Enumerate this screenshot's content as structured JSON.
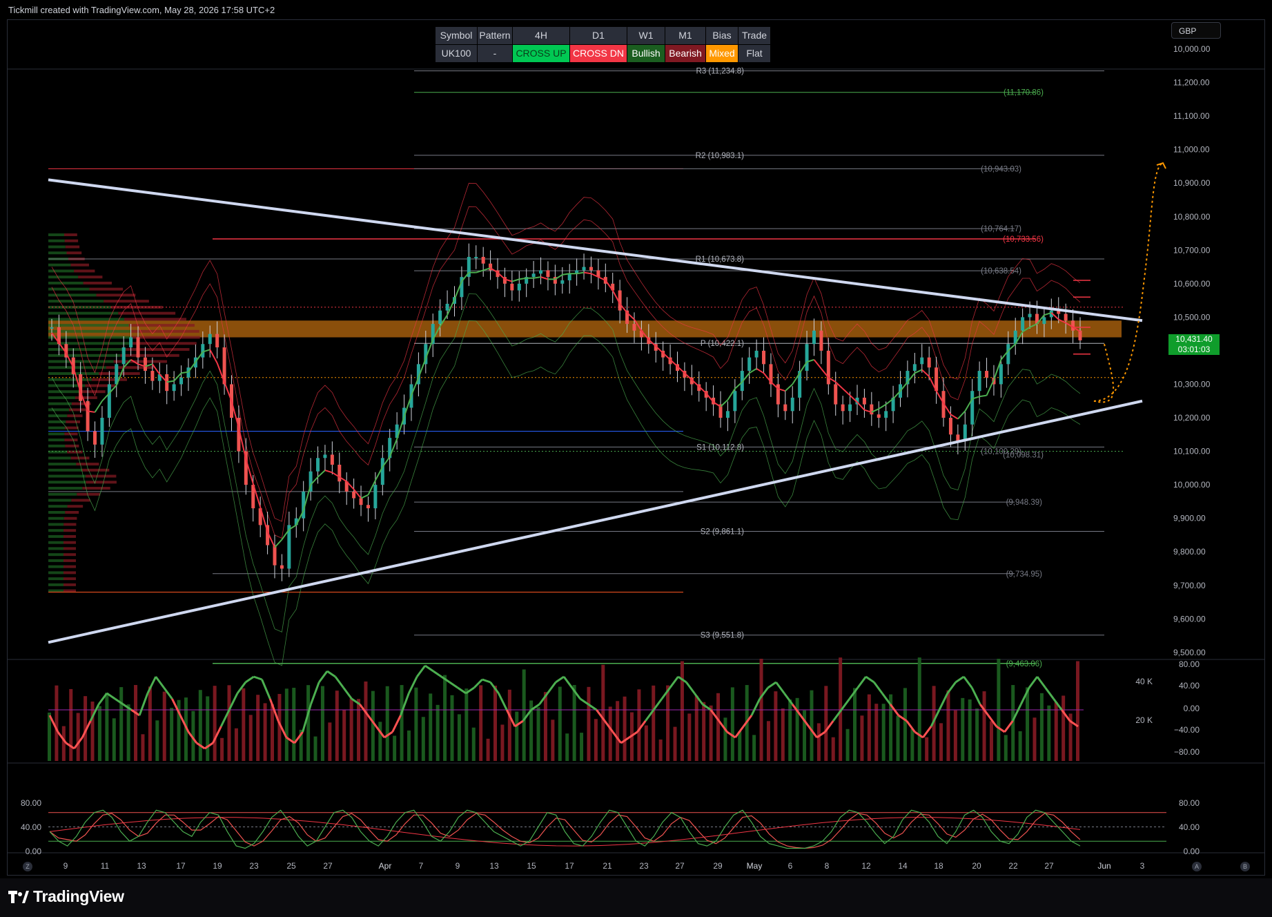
{
  "header": {
    "credit": "Tickmill created with TradingView.com, May 28, 2026 17:58 UTC+2"
  },
  "currency_button": "GBP",
  "brand": "TradingView",
  "table": {
    "headers": [
      "Symbol",
      "Pattern",
      "4H",
      "D1",
      "W1",
      "M1",
      "Bias",
      "Trade"
    ],
    "cells": [
      {
        "text": "UK100",
        "bg": "#2a2e39",
        "fg": "#d1d4dc"
      },
      {
        "text": "-",
        "bg": "#2a2e39",
        "fg": "#d1d4dc"
      },
      {
        "text": "CROSS UP",
        "bg": "#00c853",
        "fg": "#0a3d1a"
      },
      {
        "text": "CROSS DN",
        "bg": "#f23645",
        "fg": "#ffffff"
      },
      {
        "text": "Bullish",
        "bg": "#1b5e20",
        "fg": "#ffffff"
      },
      {
        "text": "Bearish",
        "bg": "#801922",
        "fg": "#ffffff"
      },
      {
        "text": "Mixed",
        "bg": "#ff9800",
        "fg": "#ffffff"
      },
      {
        "text": "Flat",
        "bg": "#2a2e39",
        "fg": "#d1d4dc"
      }
    ]
  },
  "current_price": {
    "value": "10,431.40",
    "countdown": "03:01:03"
  },
  "chart_data": {
    "type": "line",
    "symbol": "UK100",
    "price_axis": {
      "labels": [
        "10,000.00",
        "11,200.00",
        "11,100.00",
        "11,000.00",
        "10,900.00",
        "10,800.00",
        "10,700.00",
        "10,600.00",
        "10,500.00",
        "10,300.00",
        "10,200.00",
        "10,100.00",
        "10,000.00",
        "9,900.00",
        "9,800.00",
        "9,700.00",
        "9,600.00",
        "9,500.00"
      ],
      "ylim": [
        9460,
        11260
      ]
    },
    "x_axis": {
      "labels": [
        "9",
        "11",
        "13",
        "17",
        "19",
        "23",
        "25",
        "27",
        "Apr",
        "7",
        "9",
        "13",
        "15",
        "17",
        "21",
        "23",
        "27",
        "29",
        "May",
        "6",
        "8",
        "12",
        "14",
        "18",
        "20",
        "22",
        "27",
        "Jun",
        "3"
      ]
    },
    "pivot_levels": [
      {
        "label": "R3 (11,234.8)",
        "value": 11234.8
      },
      {
        "label": "R2 (10,983.1)",
        "value": 10983.1
      },
      {
        "label": "R1 (10,673.8)",
        "value": 10673.8
      },
      {
        "label": "P (10,422.1)",
        "value": 10422.1
      },
      {
        "label": "S1 (10,112.8)",
        "value": 10112.8
      },
      {
        "label": "S2 (9,861.1)",
        "value": 9861.1
      },
      {
        "label": "S3 (9,551.8)",
        "value": 9551.8
      }
    ],
    "right_levels": [
      {
        "label": "(11,170.86)",
        "value": 11170.86,
        "color": "#4caf50"
      },
      {
        "label": "(10,943.03)",
        "value": 10943.03,
        "color": "#787b86"
      },
      {
        "label": "(10,764.17)",
        "value": 10764.17,
        "color": "#787b86"
      },
      {
        "label": "(10,733.56)",
        "value": 10733.56,
        "color": "#f23645"
      },
      {
        "label": "(10,638.54)",
        "value": 10638.54,
        "color": "#787b86"
      },
      {
        "label": "(10,100.29)",
        "value": 10100.29,
        "color": "#787b86"
      },
      {
        "label": "(10,098.31)",
        "value": 10098.31,
        "color": "#787b86"
      },
      {
        "label": "(9,948.39)",
        "value": 9948.39,
        "color": "#787b86"
      },
      {
        "label": "(9,734.95)",
        "value": 9734.95,
        "color": "#787b86"
      },
      {
        "label": "(9,463.06)",
        "value": 9463.06,
        "color": "#4caf50"
      }
    ],
    "close_series": [
      10470,
      10420,
      10380,
      10330,
      10250,
      10160,
      10120,
      10200,
      10300,
      10360,
      10410,
      10440,
      10380,
      10340,
      10310,
      10330,
      10280,
      10300,
      10320,
      10350,
      10380,
      10420,
      10450,
      10410,
      10300,
      10200,
      10100,
      10000,
      9930,
      9880,
      9820,
      9760,
      9750,
      9880,
      9900,
      9980,
      10040,
      10080,
      10090,
      10060,
      10010,
      9980,
      9960,
      9940,
      9930,
      10000,
      10080,
      10140,
      10180,
      10230,
      10300,
      10360,
      10420,
      10480,
      10520,
      10540,
      10560,
      10620,
      10680,
      10680,
      10660,
      10640,
      10620,
      10600,
      10580,
      10600,
      10620,
      10630,
      10640,
      10620,
      10600,
      10610,
      10630,
      10640,
      10650,
      10640,
      10620,
      10600,
      10580,
      10520,
      10480,
      10460,
      10440,
      10420,
      10400,
      10380,
      10360,
      10340,
      10320,
      10300,
      10280,
      10260,
      10240,
      10200,
      10220,
      10280,
      10340,
      10380,
      10400,
      10360,
      10300,
      10240,
      10220,
      10260,
      10340,
      10420,
      10460,
      10400,
      10300,
      10240,
      10220,
      10240,
      10260,
      10240,
      10210,
      10200,
      10220,
      10260,
      10300,
      10340,
      10360,
      10380,
      10350,
      10280,
      10200,
      10150,
      10130,
      10180,
      10280,
      10340,
      10320,
      10300,
      10360,
      10420,
      10460,
      10500,
      10510,
      10480,
      10500,
      10520,
      10510,
      10490,
      10460,
      10431
    ],
    "volume_axis": [
      "40 K",
      "20 K"
    ],
    "cci_axis": [
      "80.00",
      "40.00",
      "0.00",
      "−40.00",
      "−80.00"
    ],
    "stoch_axis": [
      "80.00",
      "40.00",
      "0.00"
    ],
    "cci_series": [
      -10,
      -40,
      -60,
      -70,
      -50,
      -20,
      10,
      30,
      20,
      10,
      0,
      -10,
      30,
      60,
      40,
      20,
      -10,
      -40,
      -60,
      -70,
      -60,
      -30,
      0,
      30,
      50,
      60,
      55,
      20,
      -20,
      -50,
      -60,
      -40,
      10,
      50,
      70,
      60,
      40,
      20,
      10,
      -10,
      -30,
      -50,
      -40,
      -10,
      30,
      60,
      80,
      70,
      60,
      50,
      40,
      30,
      40,
      55,
      50,
      30,
      0,
      -30,
      -20,
      0,
      10,
      30,
      50,
      60,
      40,
      20,
      10,
      0,
      -20,
      -40,
      -60,
      -50,
      -40,
      -20,
      0,
      20,
      40,
      60,
      50,
      30,
      10,
      0,
      -20,
      -40,
      -50,
      -30,
      -10,
      20,
      40,
      50,
      30,
      10,
      -10,
      -30,
      -50,
      -40,
      -20,
      0,
      20,
      40,
      60,
      50,
      30,
      10,
      -10,
      -20,
      -40,
      -50,
      -30,
      0,
      30,
      50,
      60,
      40,
      10,
      -10,
      -30,
      -40,
      -20,
      10,
      40,
      60,
      40,
      20,
      0,
      -20,
      -30
    ],
    "stoch_series": [
      40,
      20,
      10,
      30,
      60,
      80,
      85,
      70,
      40,
      20,
      30,
      60,
      85,
      80,
      60,
      40,
      30,
      60,
      80,
      75,
      40,
      10,
      5,
      15,
      40,
      70,
      85,
      60,
      30,
      10,
      20,
      50,
      80,
      85,
      70,
      40,
      20,
      10,
      30,
      60,
      80,
      85,
      60,
      30,
      20,
      40,
      70,
      85,
      80,
      60,
      40,
      30,
      20,
      10,
      20,
      50,
      80,
      75,
      40,
      15,
      10,
      30,
      60,
      85,
      80,
      50,
      20,
      10,
      30,
      60,
      80,
      70,
      40,
      15,
      10,
      20,
      50,
      75,
      85,
      60,
      30,
      15,
      10,
      5,
      5,
      5,
      10,
      20,
      40,
      70,
      85,
      80,
      60,
      35,
      15,
      30,
      65,
      85,
      80,
      60,
      30,
      15,
      40,
      75,
      85,
      70,
      40,
      20,
      15,
      35,
      70,
      85,
      80,
      60,
      40,
      20,
      10
    ]
  }
}
